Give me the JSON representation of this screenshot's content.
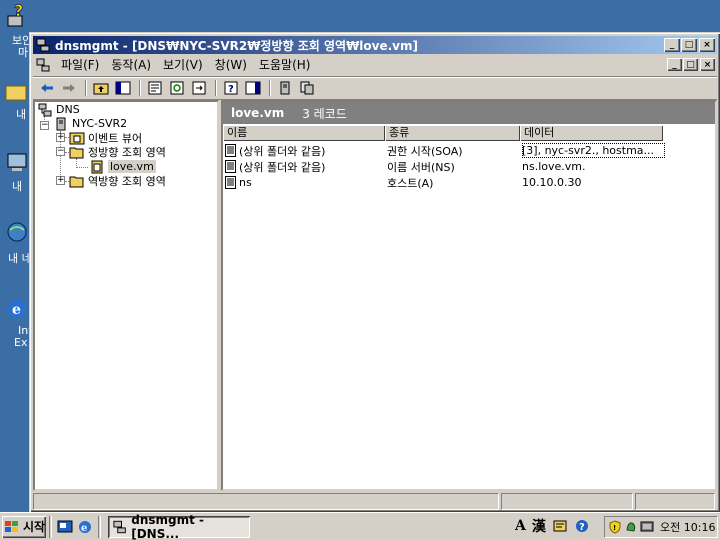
{
  "desktop": {
    "icons": [
      {
        "label": "보안",
        "label2": "마"
      },
      {
        "label": "내"
      },
      {
        "label": "내"
      },
      {
        "label": "내 네"
      },
      {
        "label": "Int",
        "label2": "Ex"
      }
    ]
  },
  "window": {
    "title": "dnsmgmt - [DNS₩NYC-SVR2₩정방향 조회 영역₩love.vm]",
    "caption_buttons": {
      "minimize": "_",
      "maximize": "□",
      "close": "×"
    },
    "menu": [
      "파일(F)",
      "동작(A)",
      "보기(V)",
      "창(W)",
      "도움말(H)"
    ]
  },
  "tree": {
    "root": "DNS",
    "server": "NYC-SVR2",
    "children": [
      {
        "label": "이벤트 뷰어",
        "expander": "+"
      },
      {
        "label": "정방향 조회 영역",
        "expander": "−"
      },
      {
        "label": "love.vm",
        "selected": true
      },
      {
        "label": "역방향 조회 영역",
        "expander": "+"
      }
    ]
  },
  "detail": {
    "zone": "love.vm",
    "record_count": "3 레코드",
    "columns": [
      "이름",
      "종류",
      "데이터"
    ],
    "rows": [
      {
        "name": "(상위 폴더와 같음)",
        "type": "권한 시작(SOA)",
        "data": "[3], nyc-svr2., hostma..."
      },
      {
        "name": "(상위 폴더와 같음)",
        "type": "이름 서버(NS)",
        "data": "ns.love.vm."
      },
      {
        "name": "ns",
        "type": "호스트(A)",
        "data": "10.10.0.30"
      }
    ]
  },
  "taskbar": {
    "start_label": "시작",
    "task_button": "dnsmgmt - [DNS...",
    "ime": [
      "A",
      "漢"
    ],
    "clock": "오전 10:16"
  },
  "colors": {
    "desktop": "#3a6ea5",
    "title_start": "#0a246a",
    "title_end": "#a6caf0",
    "face": "#d4d0c8",
    "header_gray": "#808080"
  }
}
